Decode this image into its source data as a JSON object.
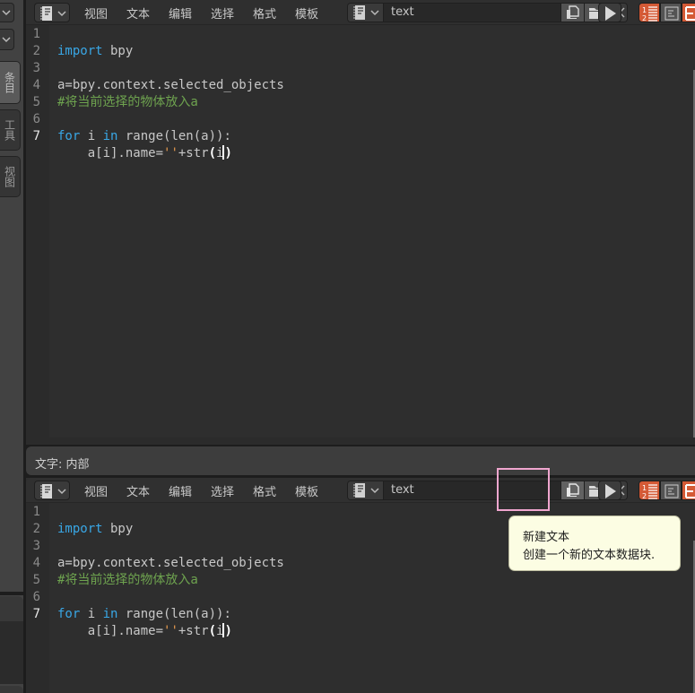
{
  "sidebar": {
    "tabs": [
      {
        "label": "条目",
        "active": true
      },
      {
        "label": "工具",
        "active": false
      },
      {
        "label": "视图",
        "active": false
      }
    ]
  },
  "editors": [
    {
      "menus": [
        "视图",
        "文本",
        "编辑",
        "选择",
        "格式",
        "模板"
      ],
      "text_block_name": "text",
      "buttons": [
        "new-text",
        "open-text",
        "unlink-text",
        "run-script"
      ],
      "toggles": [
        {
          "name": "line-numbers",
          "on": true
        },
        {
          "name": "word-wrap",
          "on": false
        },
        {
          "name": "syntax-highlight",
          "on": true
        }
      ],
      "line_numbers": [
        "1",
        "2",
        "3",
        "4",
        "5",
        "6",
        "7"
      ],
      "current_line": 7
    },
    {
      "menus": [
        "视图",
        "文本",
        "编辑",
        "选择",
        "格式",
        "模板"
      ],
      "text_block_name": "text",
      "line_numbers": [
        "1",
        "2",
        "3",
        "4",
        "5",
        "6",
        "7"
      ],
      "current_line": 7
    }
  ],
  "code": {
    "line1_kw": "import",
    "line1_rest": " bpy",
    "line3": "a=bpy.context.selected_objects",
    "line4": "#将当前选择的物体放入a",
    "line6_kw1": "for",
    "line6_mid": " i ",
    "line6_kw2": "in",
    "line6_rest": " range(len(a)):",
    "line7_a": "    a[i].name=",
    "line7_str": "''",
    "line7_b": "+str",
    "line7_paren_open": "(",
    "line7_i": "i",
    "line7_paren_close": ")"
  },
  "statusbar": {
    "text": "文字: 内部"
  },
  "tooltip": {
    "title": "新建文本",
    "description": "创建一个新的文本数据块."
  },
  "colors": {
    "accent_toggle": "#d45a36",
    "keyword": "#39a7e6",
    "comment": "#6ea34f",
    "string": "#e79a4e",
    "highlight_box": "#f0a6cf",
    "tooltip_bg": "#fcfde3"
  }
}
